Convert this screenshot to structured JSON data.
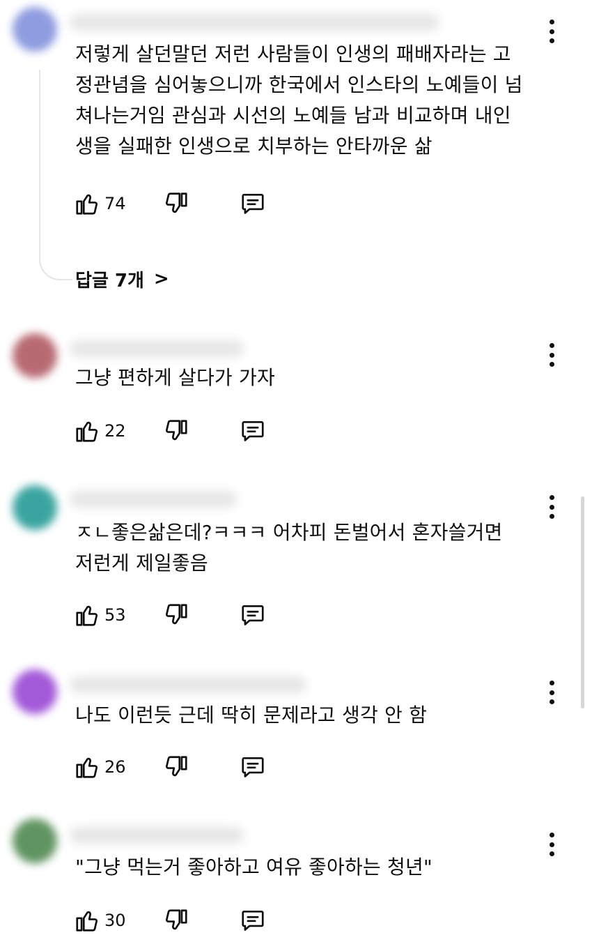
{
  "comments": [
    {
      "avatar_color": "#8f9ce0",
      "text": "저렇게 살던말던 저런 사람들이 인생의 패배자라는 고\n정관념을 심어놓으니까 한국에서 인스타의 노예들이 넘\n쳐나는거임 관심과 시선의 노예들 남과 비교하며 내인\n생을 실패한 인생으로 치부하는 안타까운 삶",
      "likes": "74",
      "replies_label": "답글 7개"
    },
    {
      "avatar_color": "#b86a72",
      "text": "그냥 편하게 살다가 가자",
      "likes": "22"
    },
    {
      "avatar_color": "#3aa5a0",
      "text": "ㅈㄴ좋은삶은데?ㅋㅋㅋ 어차피 돈벌어서 혼자쓸거면\n저런게 제일좋음",
      "likes": "53"
    },
    {
      "avatar_color": "#a35ad8",
      "text": "나도 이런듯 근데 딱히 문제라고 생각 안 함",
      "likes": "26"
    },
    {
      "avatar_color": "#5f9460",
      "text": "\"그냥 먹는거 좋아하고 여유 좋아하는 청년\"",
      "likes": "30"
    }
  ],
  "icons": {
    "like": "thumb-up-icon",
    "dislike": "thumb-down-icon",
    "reply": "comment-icon",
    "more": "more-vertical-icon",
    "expand": "chevron-right-icon"
  }
}
